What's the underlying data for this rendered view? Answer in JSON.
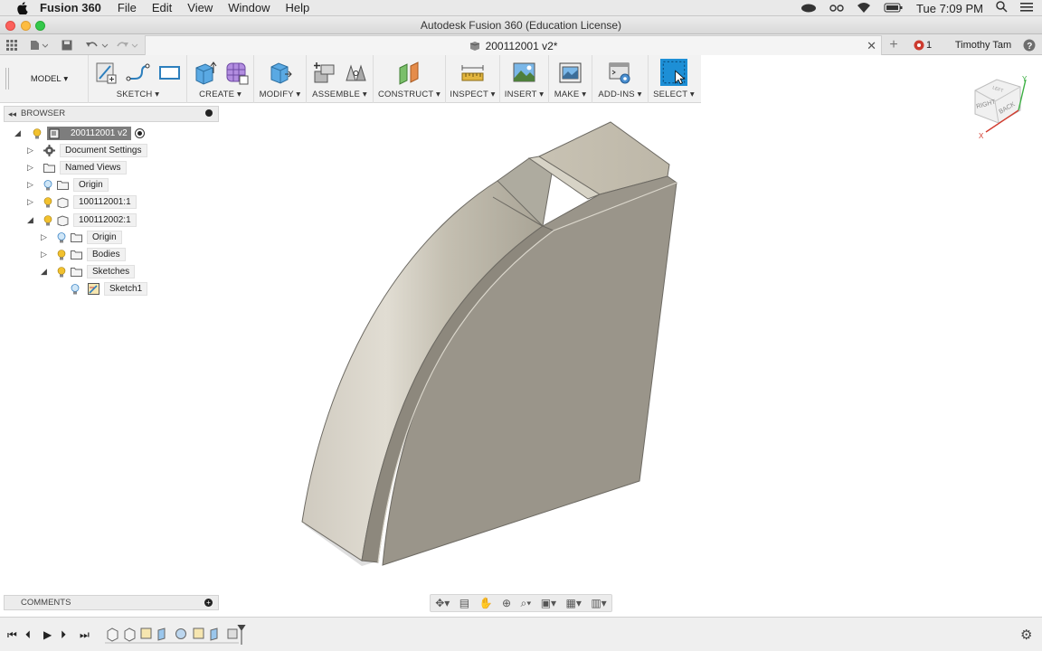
{
  "menubar": {
    "app_name": "Fusion 360",
    "menus": [
      "File",
      "Edit",
      "View",
      "Window",
      "Help"
    ],
    "clock": "Tue 7:09 PM"
  },
  "window": {
    "title": "Autodesk Fusion 360 (Education License)"
  },
  "tabbar": {
    "doc_tab": "200112001 v2*",
    "notifications": "1",
    "user": "Timothy Tam"
  },
  "toolbar": {
    "workspace": "MODEL",
    "groups": [
      "SKETCH",
      "CREATE",
      "MODIFY",
      "ASSEMBLE",
      "CONSTRUCT",
      "INSPECT",
      "INSERT",
      "MAKE",
      "ADD-INS",
      "SELECT"
    ]
  },
  "browser": {
    "title": "BROWSER",
    "root": "200112001 v2",
    "items": [
      "Document Settings",
      "Named Views",
      "Origin",
      "100112001:1",
      "100112002:1",
      "Origin",
      "Bodies",
      "Sketches",
      "Sketch1"
    ]
  },
  "comments": {
    "title": "COMMENTS"
  },
  "viewcube": {
    "faces": [
      "RIGHT",
      "BACK",
      "LEFT"
    ],
    "axes": [
      "Y",
      "X"
    ]
  },
  "colors": {
    "select_accent": "#1d8fd6",
    "model_face": "#9a958a",
    "model_top": "#c9c3b4"
  }
}
